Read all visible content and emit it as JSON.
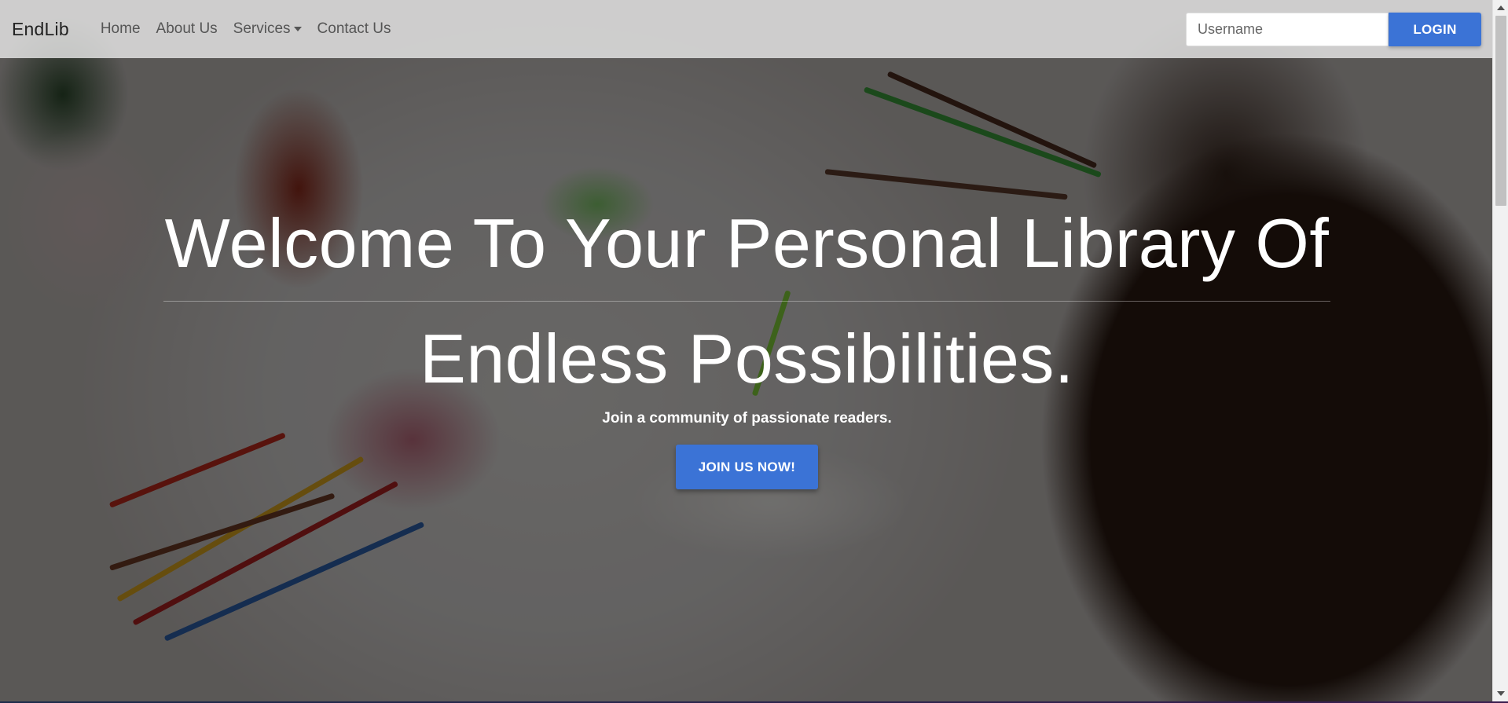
{
  "navbar": {
    "brand": "EndLib",
    "links": [
      {
        "label": "Home"
      },
      {
        "label": "About Us"
      },
      {
        "label": "Services"
      },
      {
        "label": "Contact Us"
      }
    ],
    "username_placeholder": "Username",
    "login_label": "LOGIN"
  },
  "hero": {
    "title_line1": "Welcome To Your Personal Library Of",
    "title_line2": "Endless Possibilities.",
    "subtitle": "Join a community of passionate readers.",
    "cta_label": "JOIN US NOW!"
  },
  "colors": {
    "primary": "#3b73d6",
    "navbar_bg": "#eeeeee",
    "hero_text": "#ffffff"
  },
  "icons": {
    "services_dropdown": "chevron-down-icon",
    "scroll_up": "arrow-up-icon",
    "scroll_down": "arrow-down-icon"
  }
}
